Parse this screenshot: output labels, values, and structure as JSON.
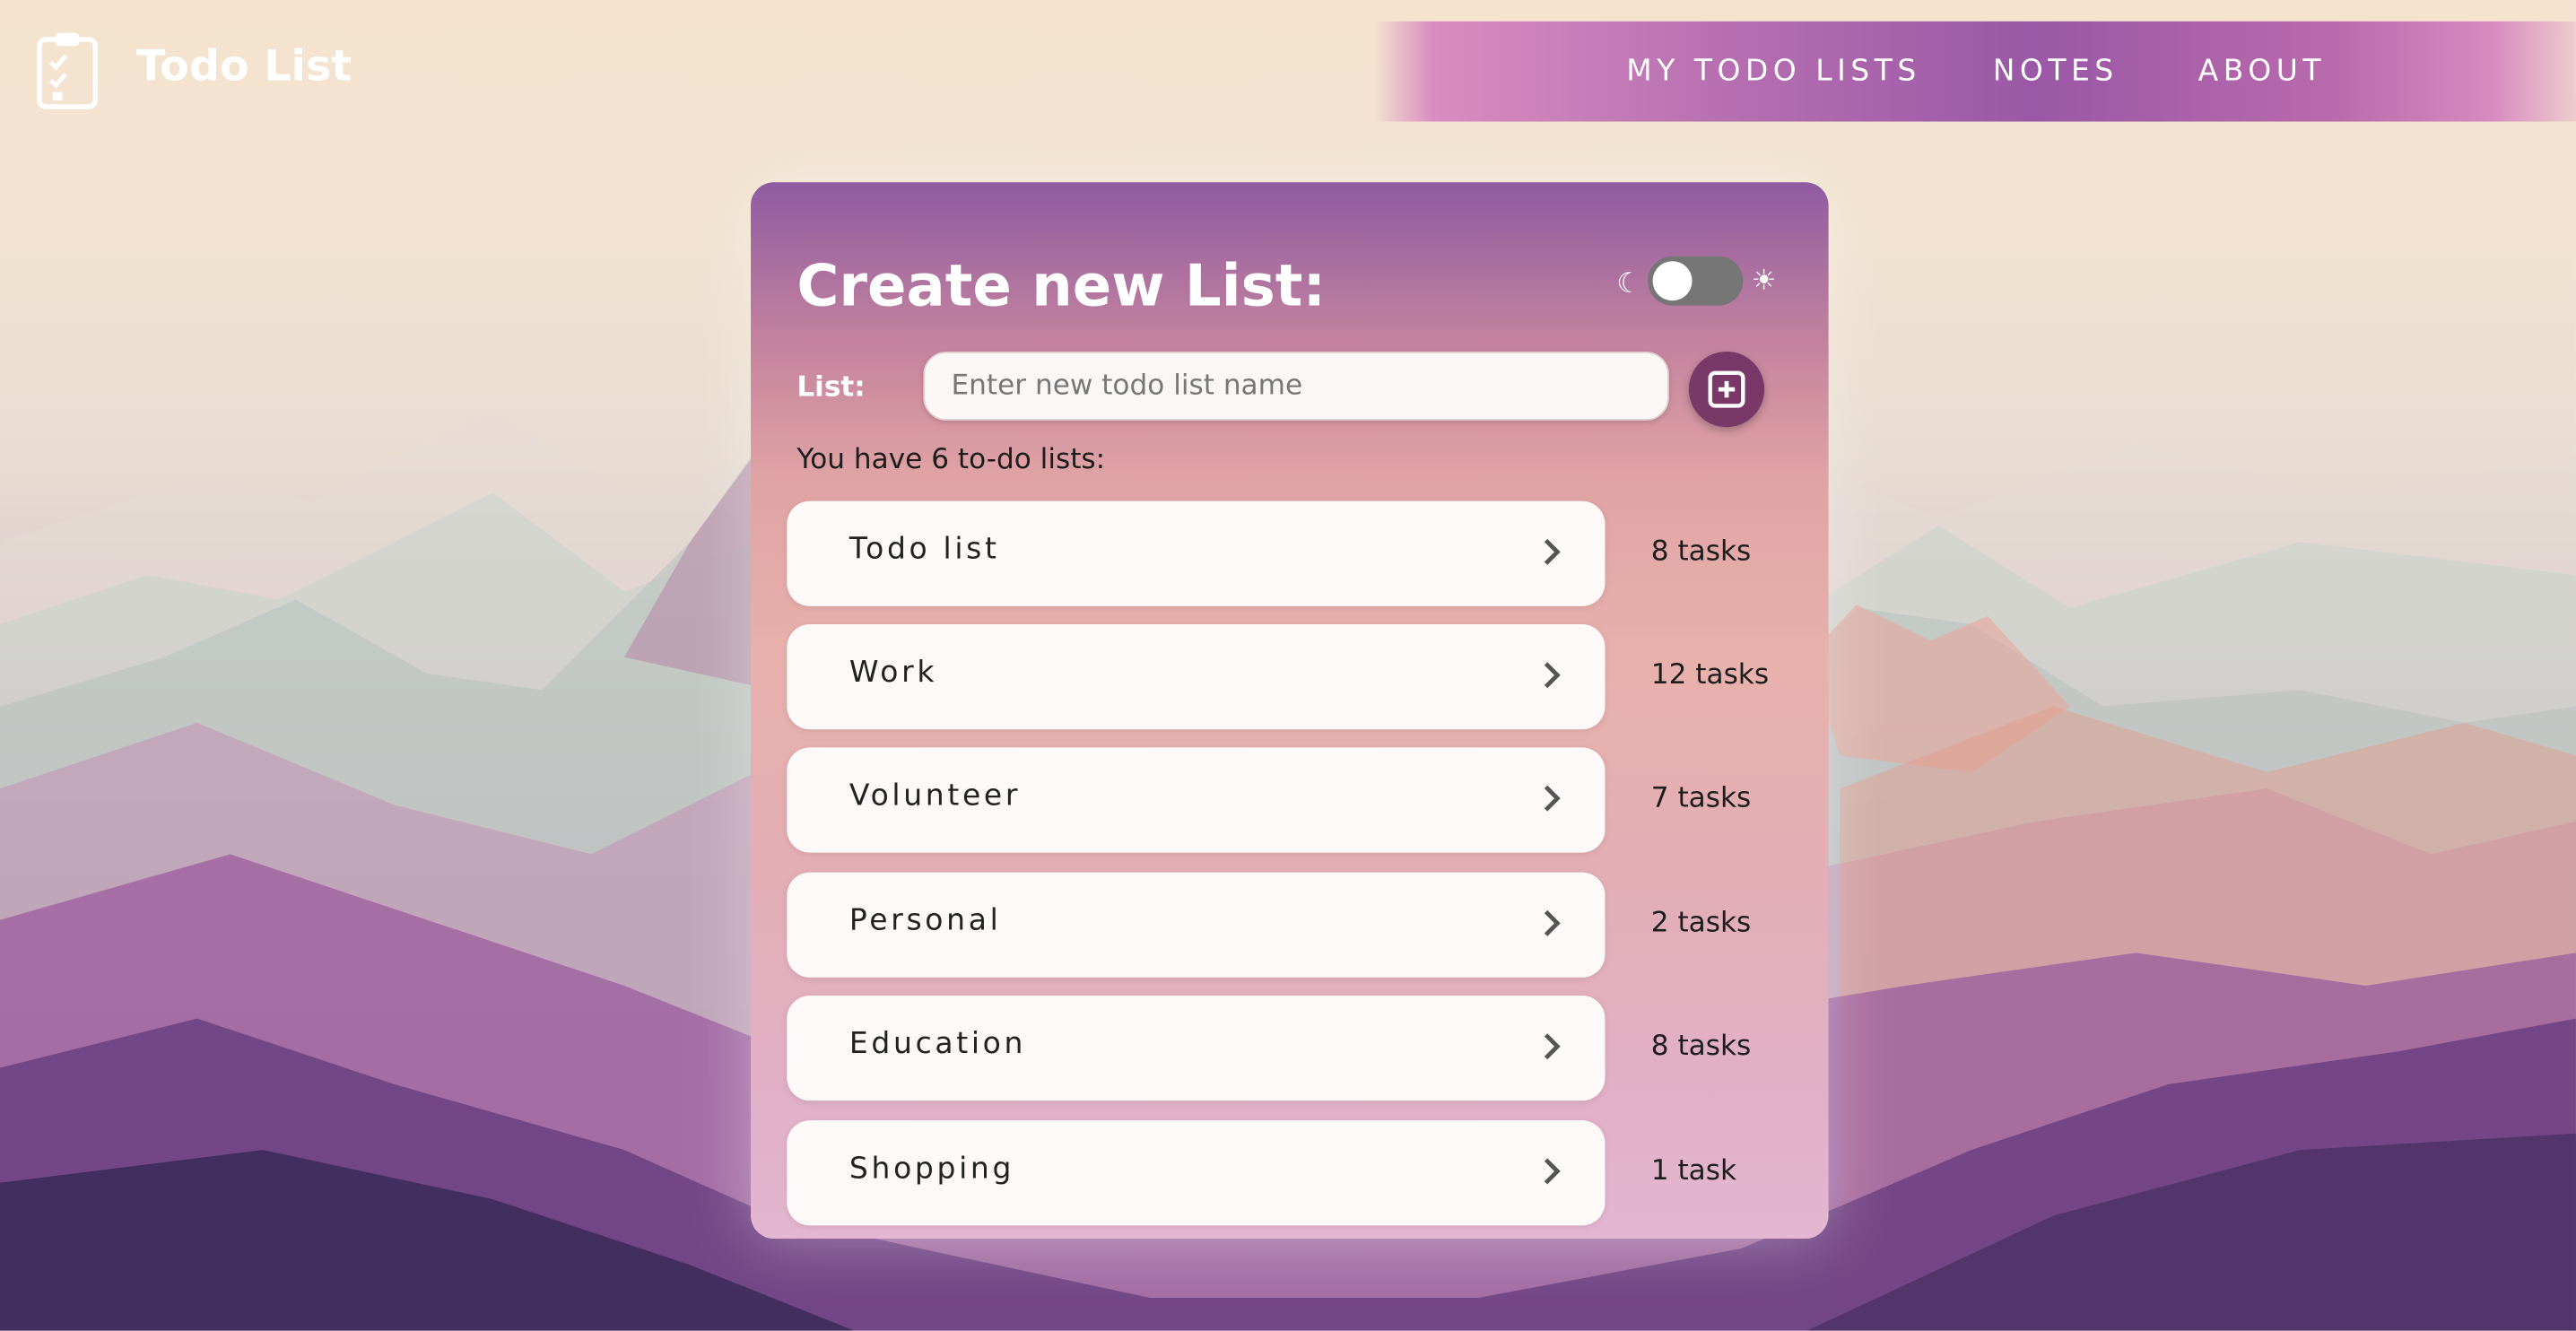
{
  "header": {
    "app_title": "Todo List",
    "logo_icon": "clipboard-check-icon",
    "nav": [
      {
        "label": "MY TODO LISTS"
      },
      {
        "label": "NOTES"
      },
      {
        "label": "ABOUT"
      }
    ]
  },
  "card": {
    "title": "Create new List:",
    "theme_toggle": {
      "state": "off",
      "left_icon": "moon-icon",
      "right_icon": "sun-icon"
    },
    "list_label": "List:",
    "input": {
      "placeholder": "Enter new todo list name",
      "value": ""
    },
    "add_button_icon": "plus-square-icon",
    "count_text": "You have 6 to-do lists:",
    "lists": [
      {
        "name": "Todo list",
        "count": "8 tasks"
      },
      {
        "name": "Work",
        "count": "12 tasks"
      },
      {
        "name": "Volunteer",
        "count": "7 tasks"
      },
      {
        "name": "Personal",
        "count": "2 tasks"
      },
      {
        "name": "Education",
        "count": "8 tasks"
      },
      {
        "name": "Shopping",
        "count": "1 task"
      }
    ]
  },
  "colors": {
    "nav_gradient": [
      "#d98cc0",
      "#9a58a6"
    ],
    "card_top": "#8f5ba2",
    "card_bottom": "#e3b6d1",
    "add_button": "#7a3868",
    "toggle_track": "#767676"
  }
}
